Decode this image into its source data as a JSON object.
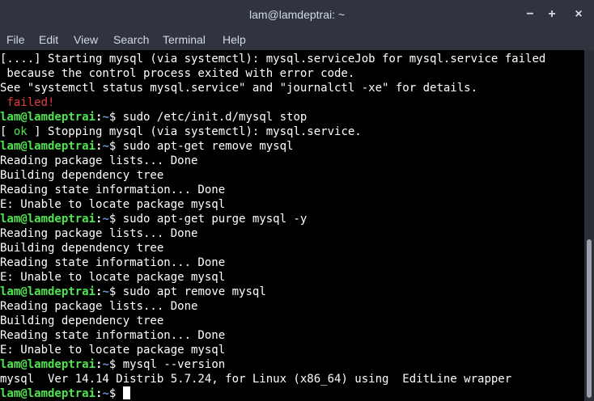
{
  "window": {
    "title": "lam@lamdeptrai: ~",
    "minimize": "−",
    "maximize": "+",
    "close": "×"
  },
  "menu": {
    "file": "File",
    "edit": "Edit",
    "view": "View",
    "search": "Search",
    "terminal": "Terminal",
    "help": "Help"
  },
  "prompt": {
    "user": "lam@lamdeptrai",
    "colon": ":",
    "path": "~",
    "symbol": "$ "
  },
  "lines": {
    "l1": "[....] Starting mysql (via systemctl): mysql.serviceJob for mysql.service failed",
    "l2": " because the control process exited with error code.",
    "l3": "See \"systemctl status mysql.service\" and \"journalctl -xe\" for details.",
    "l4_failed": " failed!",
    "c1": "sudo /etc/init.d/mysql stop",
    "l6_open": "[ ",
    "l6_ok": "ok",
    "l6_rest": " ] Stopping mysql (via systemctl): mysql.service.",
    "c2": "sudo apt-get remove mysql",
    "r1": "Reading package lists... Done",
    "r2": "Building dependency tree",
    "r3": "Reading state information... Done",
    "r4": "E: Unable to locate package mysql",
    "c3": "sudo apt-get purge mysql -y",
    "c4": "sudo apt remove mysql",
    "c5": "mysql --version",
    "version": "mysql  Ver 14.14 Distrib 5.7.24, for Linux (x86_64) using  EditLine wrapper"
  },
  "colors": {
    "prompt_user": "#4ee44e",
    "prompt_path": "#6f8fd8",
    "ok": "#4ee44e",
    "failed": "#e43c3c",
    "background": "#000000",
    "titlebar": "#2f343f"
  }
}
